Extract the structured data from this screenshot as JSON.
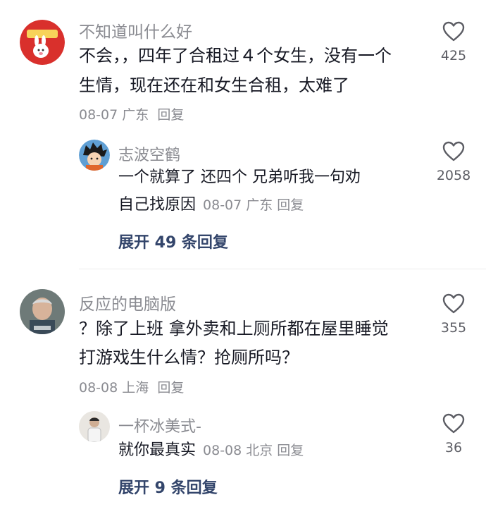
{
  "comments": [
    {
      "username": "不知道叫什么好",
      "avatar_icon": "rabbit-sticker-avatar",
      "text_lines": [
        "不会，，四年了合租过４个女生，没有一个",
        "生情，现在还在和女生合租，太难了"
      ],
      "date": "08-07",
      "location": "广东",
      "reply_label": "回复",
      "likes": "425",
      "replies": [
        {
          "username": "志波空鹤",
          "avatar_icon": "anime-boy-avatar",
          "text_lines": [
            "一个就算了 还四个  兄弟听我一句劝",
            "自己找原因"
          ],
          "date": "08-07",
          "location": "广东",
          "reply_label": "回复",
          "likes": "2058"
        }
      ],
      "expand_label": "展开 49 条回复"
    },
    {
      "username": "反应的电脑版",
      "avatar_icon": "man-photo-avatar",
      "text_lines": [
        "？除了上班 拿外卖和上厕所都在屋里睡觉",
        "打游戏生什么情？抢厕所吗？"
      ],
      "date": "08-08",
      "location": "上海",
      "reply_label": "回复",
      "likes": "355",
      "replies": [
        {
          "username": "一杯冰美式-",
          "avatar_icon": "person-photo-avatar",
          "text_lines": [
            "就你最真实"
          ],
          "date": "08-08",
          "location": "北京",
          "reply_label": "回复",
          "likes": "36"
        }
      ],
      "expand_label": "展开 9 条回复"
    }
  ],
  "colors": {
    "text": "#161823",
    "secondary": "#8a8b91",
    "link": "#33456b",
    "heart": "#5c5d64"
  }
}
